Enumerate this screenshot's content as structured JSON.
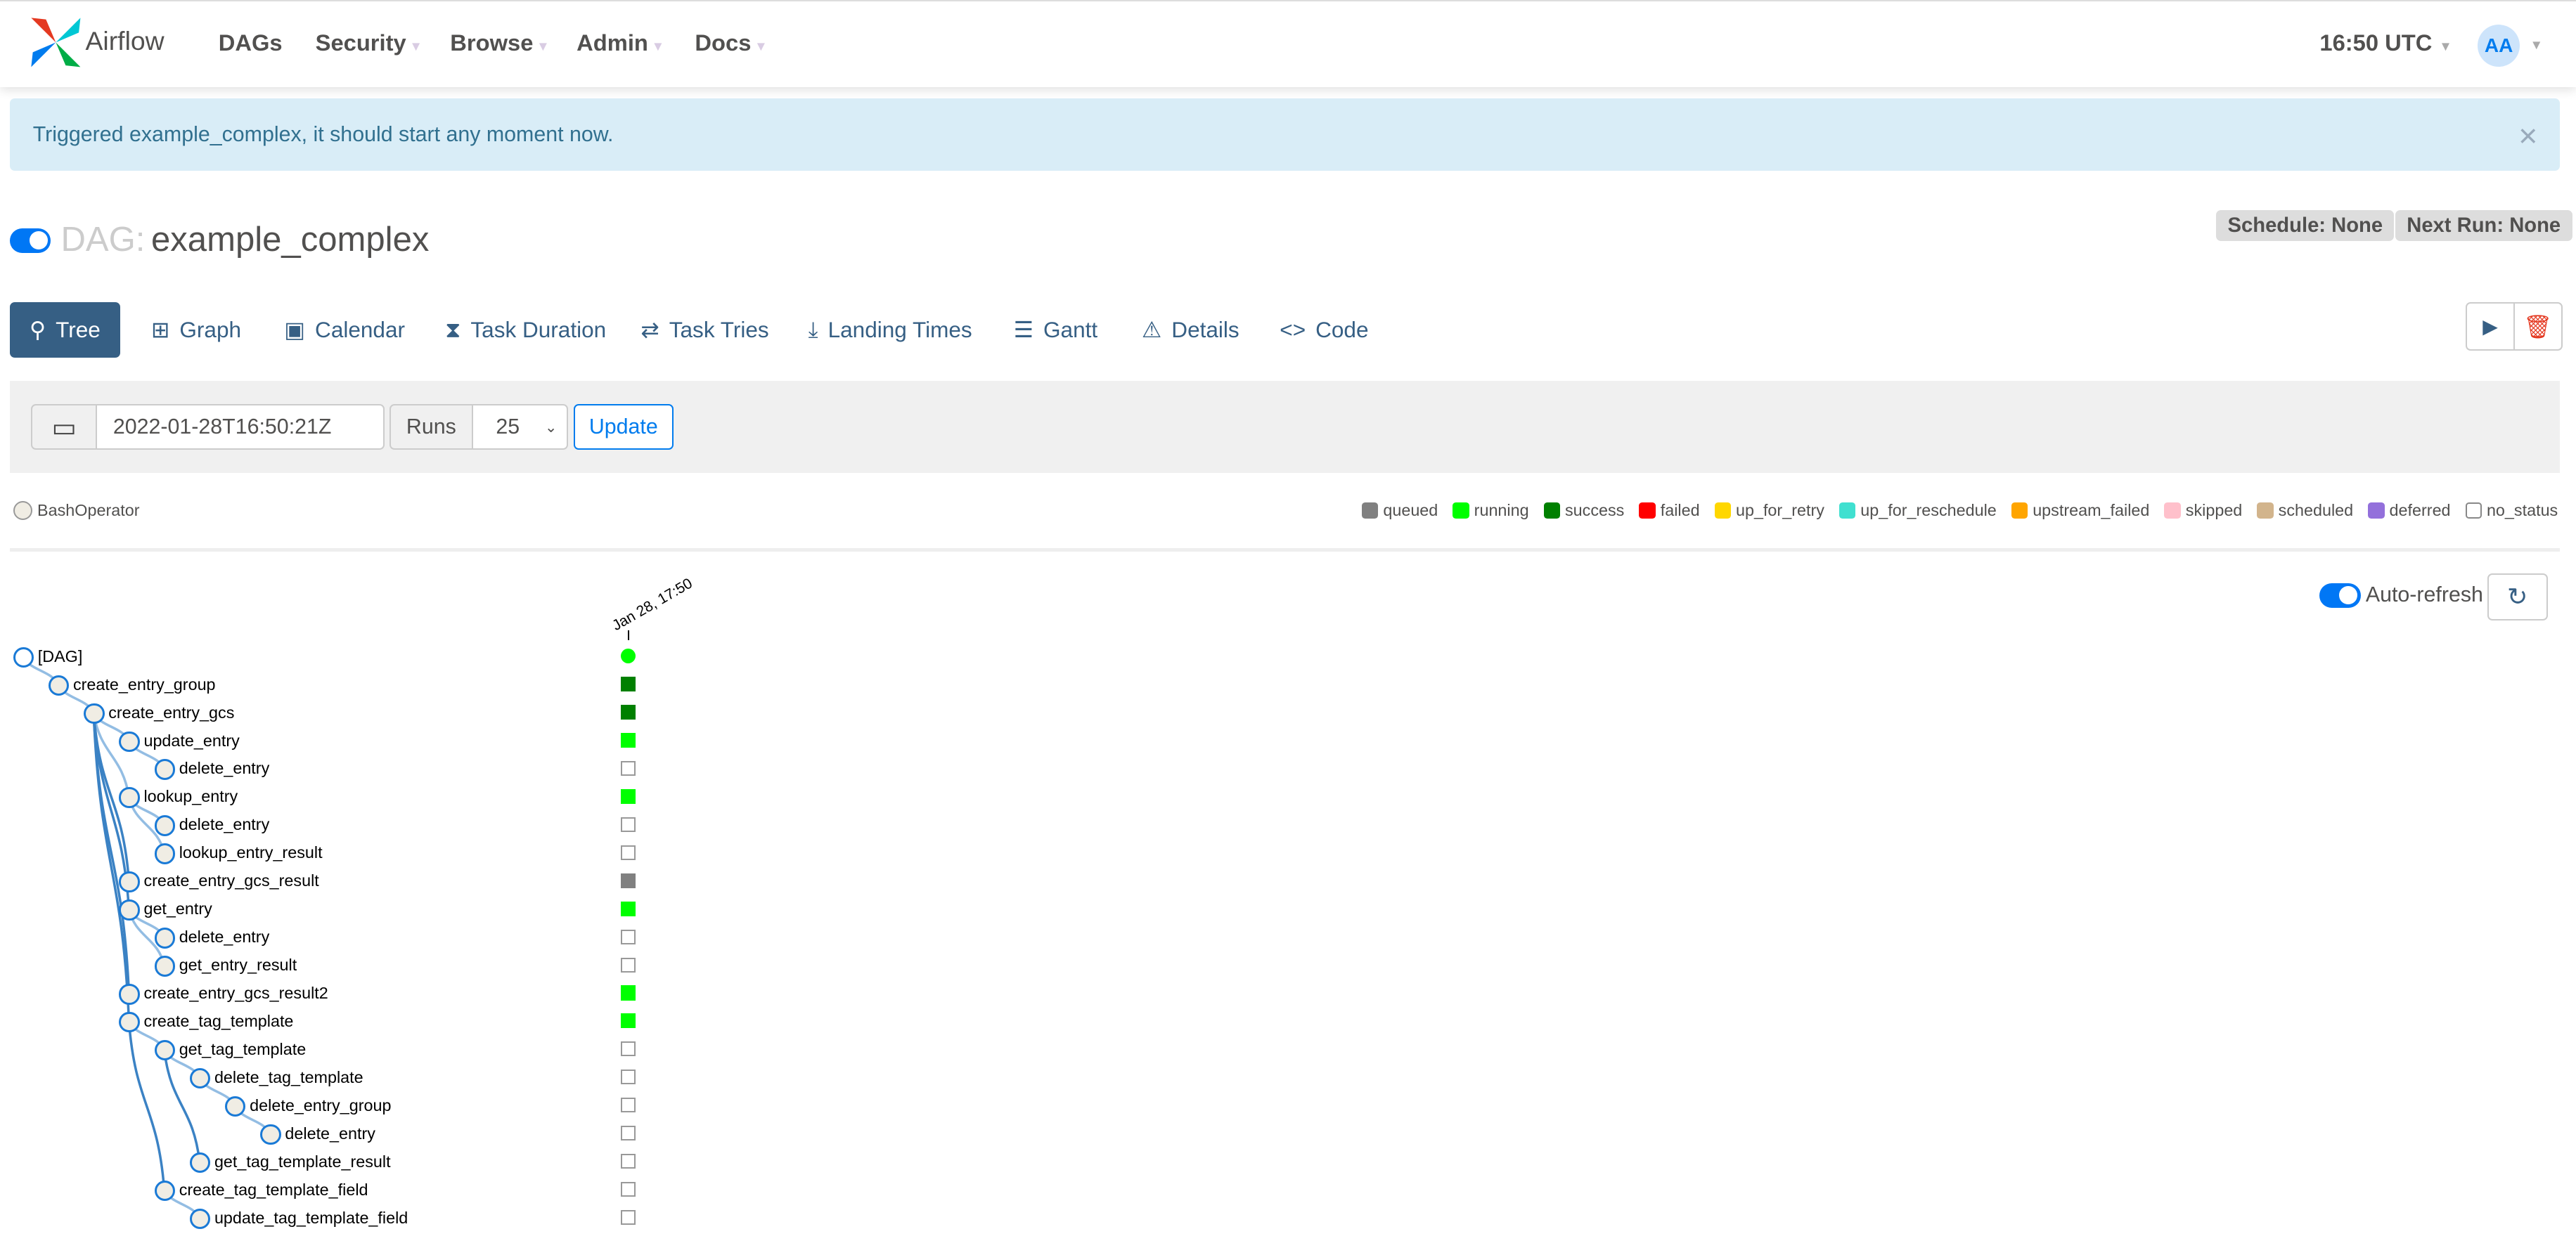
{
  "nav": {
    "brand": "Airflow",
    "items": [
      {
        "label": "DAGs",
        "caret": false
      },
      {
        "label": "Security",
        "caret": true
      },
      {
        "label": "Browse",
        "caret": true
      },
      {
        "label": "Admin",
        "caret": true
      },
      {
        "label": "Docs",
        "caret": true
      }
    ],
    "time": "16:50 UTC",
    "avatar": "AA"
  },
  "alert": {
    "message": "Triggered example_complex, it should start any moment now.",
    "close": "×"
  },
  "dag": {
    "prefix": "DAG:",
    "name": "example_complex",
    "paused": false,
    "schedule": "Schedule: None",
    "next_run": "Next Run: None"
  },
  "tabs": [
    {
      "label": "Tree",
      "icon": "tree-icon",
      "active": true
    },
    {
      "label": "Graph",
      "icon": "graph-icon"
    },
    {
      "label": "Calendar",
      "icon": "calendar-icon"
    },
    {
      "label": "Task Duration",
      "icon": "hourglass-icon"
    },
    {
      "label": "Task Tries",
      "icon": "repeat-icon"
    },
    {
      "label": "Landing Times",
      "icon": "landing-icon"
    },
    {
      "label": "Gantt",
      "icon": "gantt-icon"
    },
    {
      "label": "Details",
      "icon": "details-icon"
    },
    {
      "label": "Code",
      "icon": "code-icon"
    }
  ],
  "form": {
    "date": "2022-01-28T16:50:21Z",
    "runs_label": "Runs",
    "runs": "25",
    "update": "Update"
  },
  "operator_legend": "BashOperator",
  "states": [
    {
      "label": "queued",
      "color": "#808080"
    },
    {
      "label": "running",
      "color": "#00ff00"
    },
    {
      "label": "success",
      "color": "#008000"
    },
    {
      "label": "failed",
      "color": "#ff0000"
    },
    {
      "label": "up_for_retry",
      "color": "#ffd700"
    },
    {
      "label": "up_for_reschedule",
      "color": "#40e0d0"
    },
    {
      "label": "upstream_failed",
      "color": "#ffa500"
    },
    {
      "label": "skipped",
      "color": "#ffc0cb"
    },
    {
      "label": "scheduled",
      "color": "#d2b48c"
    },
    {
      "label": "deferred",
      "color": "#9370db"
    },
    {
      "label": "no_status",
      "color": "#ffffff"
    }
  ],
  "auto_refresh": {
    "label": "Auto-refresh",
    "on": true
  },
  "run_date": "Jan 28, 17:50",
  "tree": [
    {
      "name": "[DAG]",
      "depth": 0,
      "state": "running"
    },
    {
      "name": "create_entry_group",
      "depth": 1,
      "state": "success"
    },
    {
      "name": "create_entry_gcs",
      "depth": 2,
      "state": "success"
    },
    {
      "name": "update_entry",
      "depth": 3,
      "state": "running"
    },
    {
      "name": "delete_entry",
      "depth": 4,
      "state": "no_status"
    },
    {
      "name": "lookup_entry",
      "depth": 3,
      "state": "running"
    },
    {
      "name": "delete_entry",
      "depth": 4,
      "state": "no_status"
    },
    {
      "name": "lookup_entry_result",
      "depth": 4,
      "state": "no_status"
    },
    {
      "name": "create_entry_gcs_result",
      "depth": 3,
      "state": "queued"
    },
    {
      "name": "get_entry",
      "depth": 3,
      "state": "running"
    },
    {
      "name": "delete_entry",
      "depth": 4,
      "state": "no_status"
    },
    {
      "name": "get_entry_result",
      "depth": 4,
      "state": "no_status"
    },
    {
      "name": "create_entry_gcs_result2",
      "depth": 3,
      "state": "running"
    },
    {
      "name": "create_tag_template",
      "depth": 3,
      "state": "running"
    },
    {
      "name": "get_tag_template",
      "depth": 4,
      "state": "no_status"
    },
    {
      "name": "delete_tag_template",
      "depth": 5,
      "state": "no_status"
    },
    {
      "name": "delete_entry_group",
      "depth": 6,
      "state": "no_status"
    },
    {
      "name": "delete_entry",
      "depth": 7,
      "state": "no_status"
    },
    {
      "name": "get_tag_template_result",
      "depth": 5,
      "state": "no_status"
    },
    {
      "name": "create_tag_template_field",
      "depth": 4,
      "state": "no_status"
    },
    {
      "name": "update_tag_template_field",
      "depth": 5,
      "state": "no_status"
    }
  ]
}
